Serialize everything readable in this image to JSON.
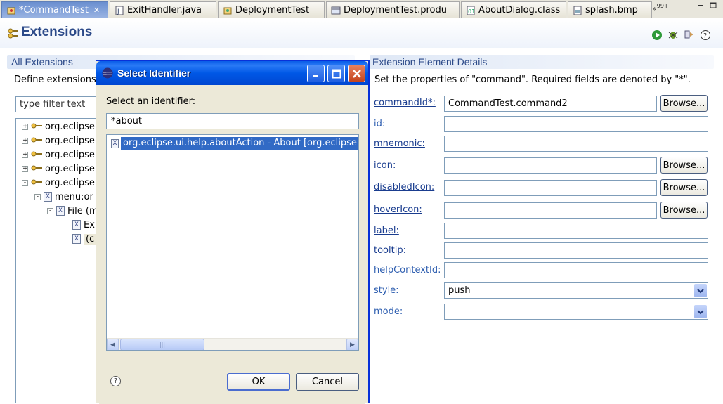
{
  "tabs": [
    {
      "label": "*CommandTest",
      "active": true,
      "icon": "plugin-icon",
      "closable": true
    },
    {
      "label": "ExitHandler.java",
      "icon": "java-file-icon"
    },
    {
      "label": "DeploymentTest",
      "icon": "plugin-icon"
    },
    {
      "label": "DeploymentTest.produ",
      "icon": "product-icon"
    },
    {
      "label": "AboutDialog.class",
      "icon": "class-file-icon"
    },
    {
      "label": "splash.bmp",
      "icon": "image-file-icon"
    }
  ],
  "tab_overflow": {
    "symbol": "»",
    "count": "99+"
  },
  "header": {
    "title": "Extensions",
    "actions": [
      "run-icon",
      "debug-icon",
      "export-icon",
      "help-icon"
    ]
  },
  "left_section": {
    "title": "All Extensions",
    "description": "Define extensions fo",
    "filter_value": "type filter text",
    "tree": [
      {
        "label": "org.eclipse.",
        "depth": 0,
        "expander": "+"
      },
      {
        "label": "org.eclipse.",
        "depth": 0,
        "expander": "+"
      },
      {
        "label": "org.eclipse.",
        "depth": 0,
        "expander": "+"
      },
      {
        "label": "org.eclipse.",
        "depth": 0,
        "expander": "+"
      },
      {
        "label": "org.eclipse.",
        "depth": 0,
        "expander": "-"
      },
      {
        "label": "menu:or",
        "depth": 1,
        "expander": "-"
      },
      {
        "label": "File (m",
        "depth": 2,
        "expander": "-"
      },
      {
        "label": "Ex",
        "depth": 3,
        "expander": ""
      },
      {
        "label": "(c",
        "depth": 3,
        "expander": ""
      }
    ]
  },
  "right_section": {
    "title": "Extension Element Details",
    "description": "Set the properties of \"command\". Required fields are denoted by \"*\".",
    "fields": [
      {
        "label": "commandId*:",
        "value": "CommandTest.command2",
        "browse": true,
        "link": true
      },
      {
        "label": "id:",
        "value": "",
        "browse": false,
        "link": false
      },
      {
        "label": "mnemonic:",
        "value": "",
        "browse": false,
        "link": true
      },
      {
        "label": "icon:",
        "value": "",
        "browse": true,
        "link": true
      },
      {
        "label": "disabledIcon:",
        "value": "",
        "browse": true,
        "link": true
      },
      {
        "label": "hoverIcon:",
        "value": "",
        "browse": true,
        "link": true
      },
      {
        "label": "label:",
        "value": "",
        "browse": false,
        "link": true
      },
      {
        "label": "tooltip:",
        "value": "",
        "browse": false,
        "link": true
      },
      {
        "label": "helpContextId:",
        "value": "",
        "browse": false,
        "link": false
      },
      {
        "label": "style:",
        "value": "push",
        "combo": true,
        "link": false
      },
      {
        "label": "mode:",
        "value": "",
        "combo": true,
        "link": false
      }
    ],
    "browse_label": "Browse..."
  },
  "dialog": {
    "title": "Select Identifier",
    "prompt": "Select an identifier:",
    "search_value": "*about",
    "results": [
      "org.eclipse.ui.help.aboutAction - About [org.eclipse.ui]"
    ],
    "ok_label": "OK",
    "cancel_label": "Cancel"
  },
  "colors": {
    "section_title": "#2c4a89",
    "selection": "#316ac5",
    "dialog_titlebar": "#0058e6"
  }
}
